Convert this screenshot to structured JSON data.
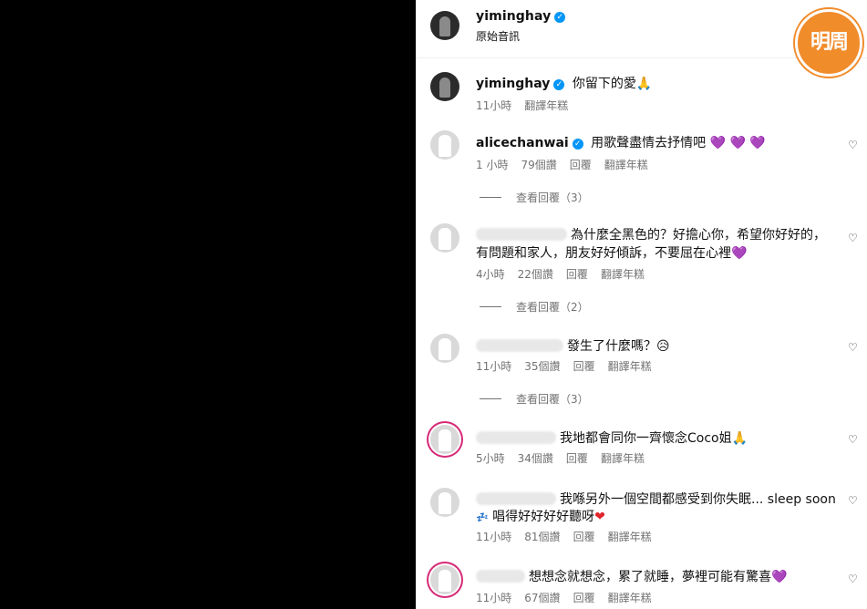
{
  "header": {
    "username": "yiminghay",
    "subtitle": "原始音訊"
  },
  "caption": {
    "username": "yiminghay",
    "text": "你留下的愛🙏",
    "time": "11小時",
    "translate": "翻譯年糕"
  },
  "comments": [
    {
      "username": "alicechanwai",
      "text": "用歌聲盡情去抒情吧",
      "emoji": "💜 💜 💜",
      "time": "1 小時",
      "likes": "79個讚",
      "reply": "回覆",
      "translate": "翻譯年糕",
      "view_replies": "查看回覆（3）"
    },
    {
      "text_line1": "為什麼全黑色的？好擔心你，希望你好好的，",
      "text_line2": "有問題和家人，朋友好好傾訴，不要屈在心裡",
      "emoji": "💜",
      "time": "4小時",
      "likes": "22個讚",
      "reply": "回覆",
      "translate": "翻譯年糕",
      "view_replies": "查看回覆（2）"
    },
    {
      "text": "發生了什麼嗎？",
      "emoji": "😥",
      "time": "11小時",
      "likes": "35個讚",
      "reply": "回覆",
      "translate": "翻譯年糕",
      "view_replies": "查看回覆（3）"
    },
    {
      "text": "我地都會同你一齊懷念Coco姐🙏",
      "time": "5小時",
      "likes": "34個讚",
      "reply": "回覆",
      "translate": "翻譯年糕"
    },
    {
      "text_line1": "我喺另外一個空間都感受到你失眠... sleep soon",
      "text_line2": "唱得好好好好聽呀",
      "emoji": "❤",
      "time": "11小時",
      "likes": "81個讚",
      "reply": "回覆",
      "translate": "翻譯年糕"
    },
    {
      "username_fragment": "_ _ _ _ _",
      "text": "想想念就想念，累了就睡，夢裡可能有驚喜",
      "emoji": "💜",
      "time": "11小時",
      "likes": "67個讚",
      "reply": "回覆",
      "translate": "翻譯年糕"
    }
  ],
  "watermark": {
    "text": "明周"
  }
}
